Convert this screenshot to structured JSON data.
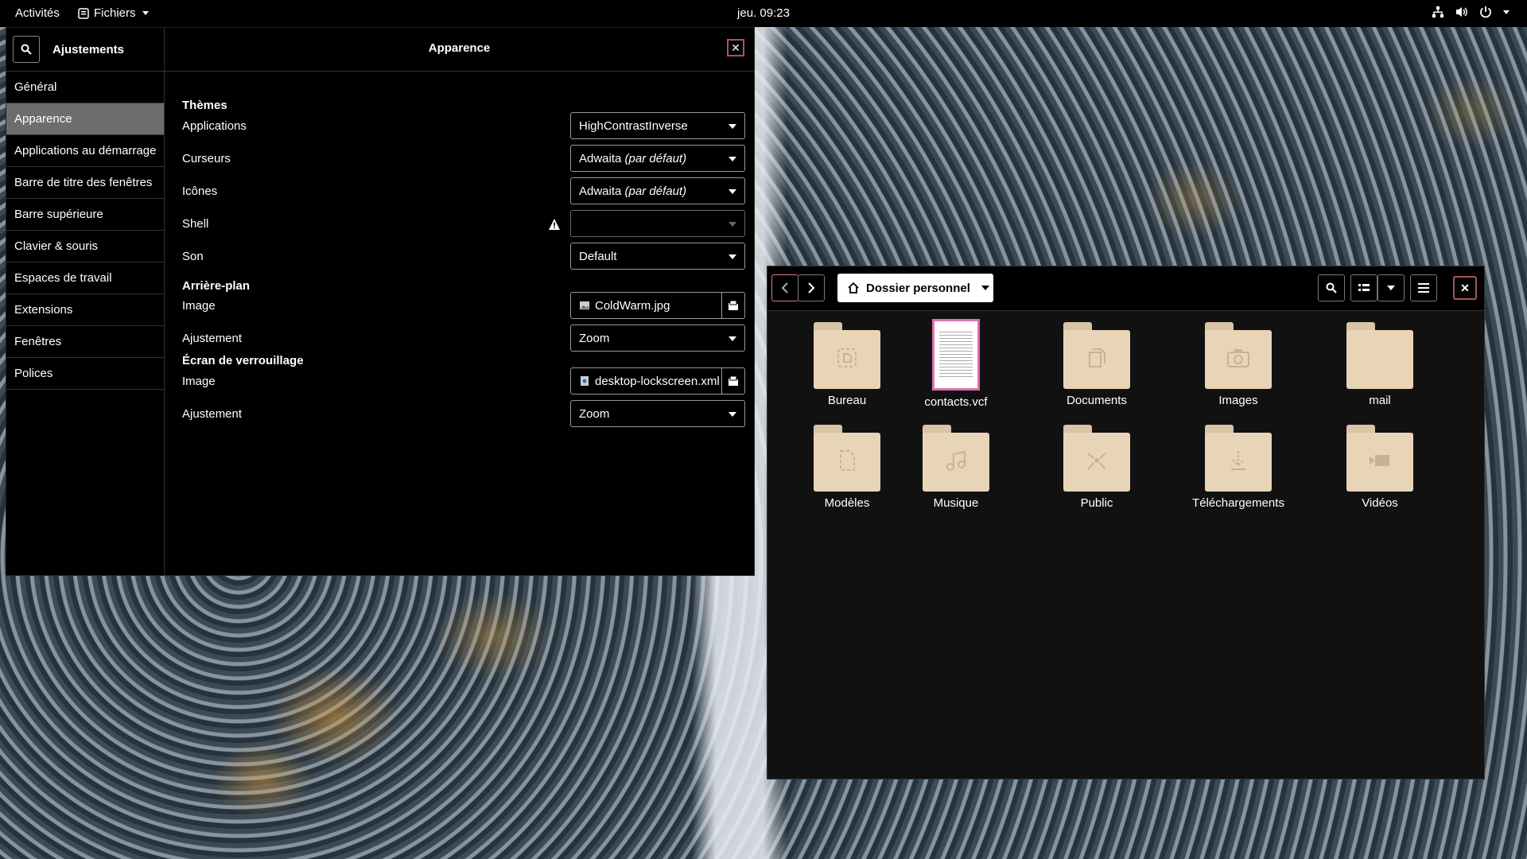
{
  "topbar": {
    "activities": "Activités",
    "app_menu": "Fichiers",
    "clock": "jeu. 09:23"
  },
  "tweaks": {
    "header_left": "Ajustements",
    "title": "Apparence",
    "sidebar": [
      {
        "label": "Général"
      },
      {
        "label": "Apparence"
      },
      {
        "label": "Applications au démarrage"
      },
      {
        "label": "Barre de titre des fenêtres"
      },
      {
        "label": "Barre supérieure"
      },
      {
        "label": "Clavier & souris"
      },
      {
        "label": "Espaces de travail"
      },
      {
        "label": "Extensions"
      },
      {
        "label": "Fenêtres"
      },
      {
        "label": "Polices"
      }
    ],
    "themes": {
      "heading": "Thèmes",
      "applications_label": "Applications",
      "applications_value": "HighContrastInverse",
      "cursors_label": "Curseurs",
      "cursors_value": "Adwaita",
      "icons_label": "Icônes",
      "icons_value": "Adwaita",
      "default_suffix": "(par défaut)",
      "shell_label": "Shell",
      "shell_value": "",
      "sound_label": "Son",
      "sound_value": "Default"
    },
    "background": {
      "heading": "Arrière-plan",
      "image_label": "Image",
      "image_value": "ColdWarm.jpg",
      "adjust_label": "Ajustement",
      "adjust_value": "Zoom"
    },
    "lockscreen": {
      "heading": "Écran de verrouillage",
      "image_label": "Image",
      "image_value": "desktop-lockscreen.xml",
      "adjust_label": "Ajustement",
      "adjust_value": "Zoom"
    }
  },
  "files": {
    "location": "Dossier personnel",
    "items": [
      {
        "label": "Bureau",
        "icon": "desktop-folder-icon"
      },
      {
        "label": "contacts.vcf",
        "icon": "text-file-icon"
      },
      {
        "label": "Documents",
        "icon": "documents-folder-icon"
      },
      {
        "label": "Images",
        "icon": "pictures-folder-icon"
      },
      {
        "label": "mail",
        "icon": "folder-icon"
      },
      {
        "label": "Modèles",
        "icon": "templates-folder-icon"
      },
      {
        "label": "Musique",
        "icon": "music-folder-icon"
      },
      {
        "label": "Public",
        "icon": "public-folder-icon"
      },
      {
        "label": "Téléchargements",
        "icon": "downloads-folder-icon"
      },
      {
        "label": "Vidéos",
        "icon": "videos-folder-icon"
      }
    ]
  }
}
